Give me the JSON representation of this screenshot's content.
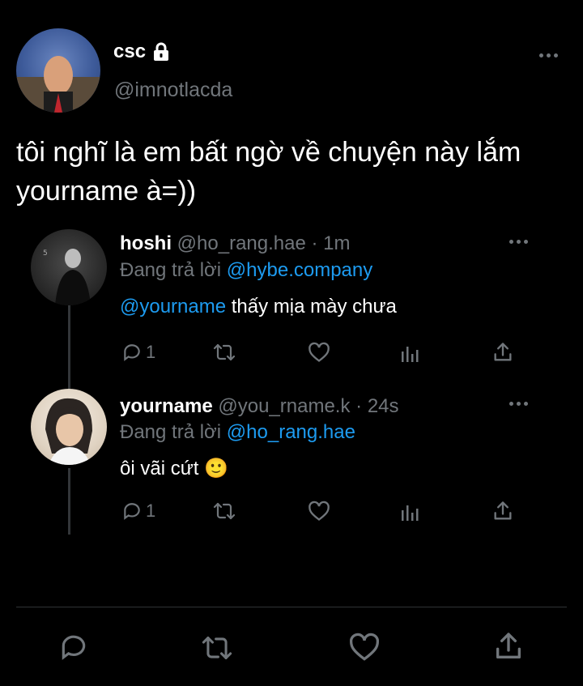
{
  "main_tweet": {
    "display_name": "csc",
    "handle": "@imnotlacda",
    "text_line1": "tôi nghĩ là em bất ngờ về chuyện này lắm",
    "text_line2": "yourname à=))"
  },
  "replies": [
    {
      "display_name": "hoshi",
      "handle": "@ho_rang.hae",
      "separator": "·",
      "time": "1m",
      "replying_prefix": "Đang trả lời",
      "replying_to": "@hybe.company",
      "mention": "@yourname",
      "text": "thấy mịa mày chưa",
      "reply_count": "1"
    },
    {
      "display_name": "yourname",
      "handle": "@you_rname.k",
      "separator": "·",
      "time": "24s",
      "replying_prefix": "Đang trả lời",
      "replying_to": "@ho_rang.hae",
      "text": "ôi vãi cứt",
      "emoji": "🙂",
      "reply_count": "1"
    }
  ],
  "icons": {
    "lock": "lock-icon",
    "more": "more-icon",
    "reply": "reply-icon",
    "retweet": "retweet-icon",
    "like": "heart-icon",
    "views": "views-icon",
    "share": "share-icon"
  },
  "colors": {
    "background": "#000000",
    "text": "#e7e9ea",
    "muted": "#71767b",
    "link": "#1d9bf0"
  }
}
